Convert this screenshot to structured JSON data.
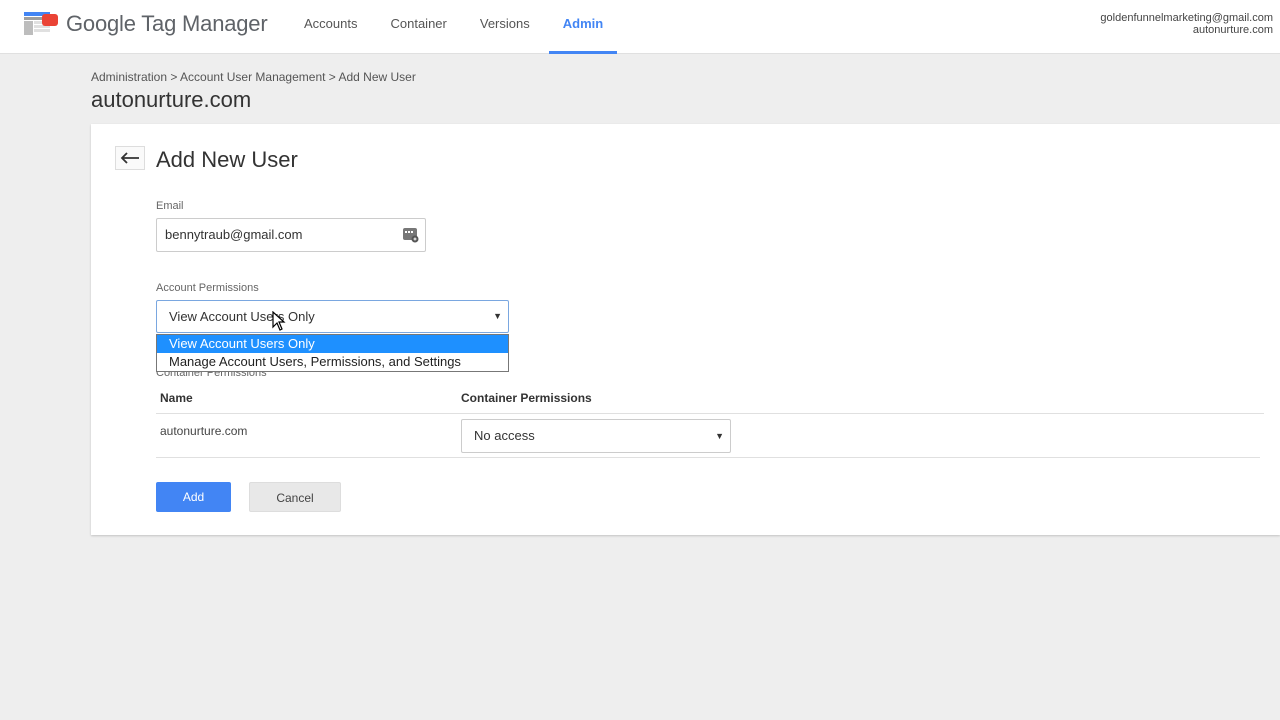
{
  "app": {
    "product_name": "Google Tag Manager",
    "brand_colors": {
      "blue": "#4285f4",
      "red": "#ea4335",
      "gray": "#9e9e9e"
    }
  },
  "nav": {
    "items": [
      {
        "label": "Accounts"
      },
      {
        "label": "Container"
      },
      {
        "label": "Versions"
      },
      {
        "label": "Admin",
        "active": true
      }
    ]
  },
  "account": {
    "email": "goldenfunnelmarketing@gmail.com",
    "name": "autonurture.com"
  },
  "breadcrumb": {
    "items": [
      "Administration",
      "Account User Management",
      "Add New User"
    ],
    "separator": " > "
  },
  "page": {
    "title": "autonurture.com"
  },
  "form": {
    "title": "Add New User",
    "back_icon": "arrow-back-icon",
    "email_label": "Email",
    "email_value": "bennytraub@gmail.com",
    "account_permissions_label": "Account Permissions",
    "account_permissions_value": "View Account Users Only",
    "account_permissions_options": [
      "View Account Users Only",
      "Manage Account Users, Permissions, and Settings"
    ],
    "container_permissions_label": "Container Permissions",
    "table": {
      "headers": [
        "Name",
        "Container Permissions"
      ],
      "rows": [
        {
          "name": "autonurture.com",
          "permission": "No access"
        }
      ]
    },
    "add_label": "Add",
    "cancel_label": "Cancel"
  }
}
